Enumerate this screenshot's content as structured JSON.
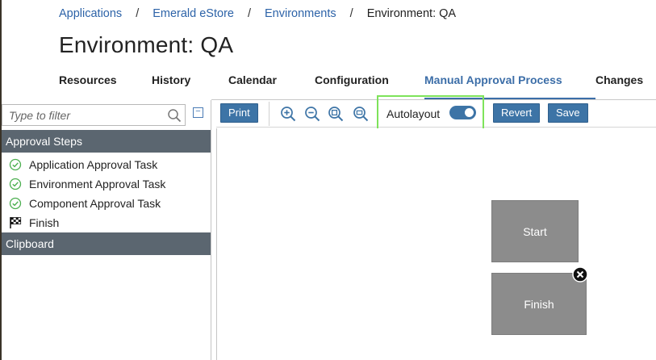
{
  "breadcrumb": {
    "items": [
      "Applications",
      "Emerald eStore",
      "Environments"
    ],
    "current": "Environment: QA",
    "separator": "/"
  },
  "page": {
    "title": "Environment: QA"
  },
  "tabs": [
    {
      "label": "Resources",
      "active": false
    },
    {
      "label": "History",
      "active": false
    },
    {
      "label": "Calendar",
      "active": false
    },
    {
      "label": "Configuration",
      "active": false
    },
    {
      "label": "Manual Approval Process",
      "active": true
    },
    {
      "label": "Changes",
      "active": false
    }
  ],
  "filter": {
    "placeholder": "Type to filter"
  },
  "sidebar": {
    "approval_steps_header": "Approval Steps",
    "steps": [
      {
        "label": "Application Approval Task",
        "icon": "check-circle-icon"
      },
      {
        "label": "Environment Approval Task",
        "icon": "check-circle-icon"
      },
      {
        "label": "Component Approval Task",
        "icon": "check-circle-icon"
      },
      {
        "label": "Finish",
        "icon": "checkered-flag-icon"
      }
    ],
    "clipboard_header": "Clipboard"
  },
  "toolbar": {
    "print_label": "Print",
    "autolayout_label": "Autolayout",
    "autolayout_on": true,
    "revert_label": "Revert",
    "save_label": "Save"
  },
  "canvas": {
    "nodes": [
      {
        "label": "Start"
      },
      {
        "label": "Finish"
      }
    ]
  },
  "colors": {
    "link": "#2d63a8",
    "accent": "#3d74a6",
    "section_header": "#5b6670",
    "node": "#8c8c8c",
    "highlight": "#7ee35a",
    "success": "#4caf50"
  }
}
